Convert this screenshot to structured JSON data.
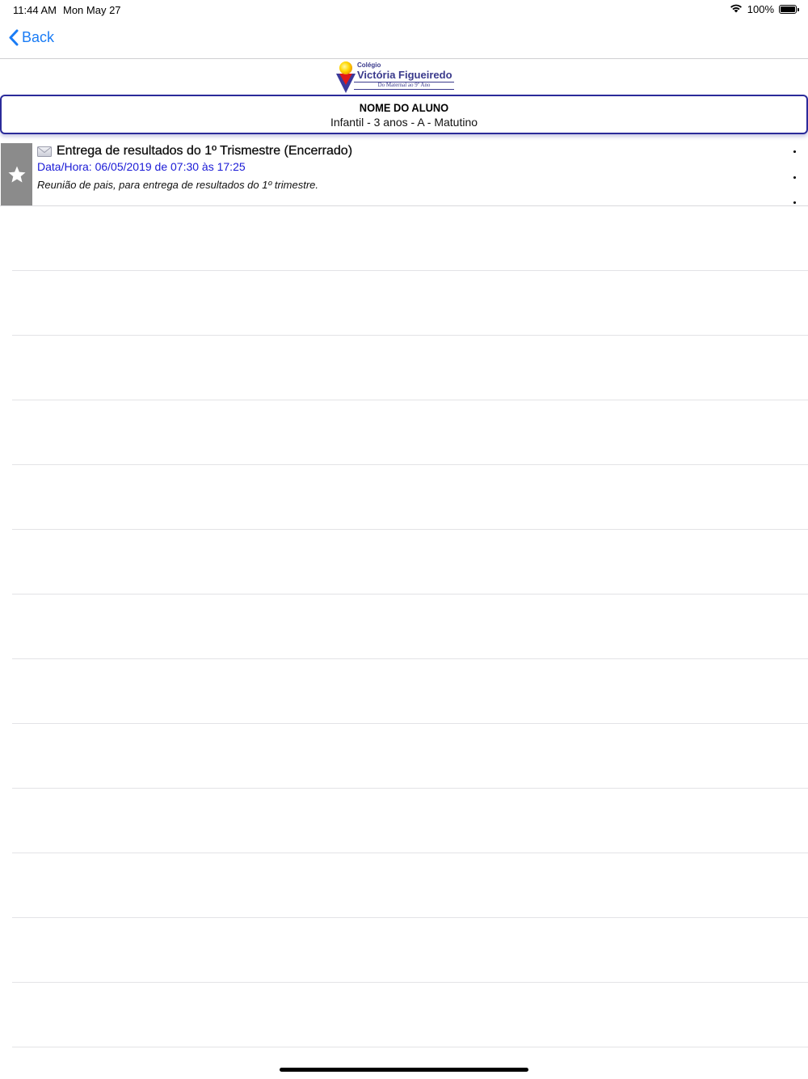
{
  "status_bar": {
    "time": "11:44 AM",
    "date": "Mon May 27",
    "battery_text": "100%",
    "battery_level": 1.0,
    "icons": [
      "wifi-icon",
      "battery-icon"
    ]
  },
  "nav": {
    "back_label": "Back",
    "back_icon": "chevron-left-icon",
    "accent_color": "#1a7cf5"
  },
  "logo": {
    "small": "Colégio",
    "name": "Victória Figueiredo",
    "tagline": "Do Maternal ao 9º Ano"
  },
  "student": {
    "name": "NOME DO ALUNO",
    "class_info": "Infantil - 3 anos - A - Matutino",
    "border_color": "#2b2b9a"
  },
  "events": [
    {
      "title": "Entrega de resultados do 1º Trismestre (Encerrado)",
      "datetime": "Data/Hora: 06/05/2019 de 07:30 às 17:25",
      "description": "Reunião de pais, para entrega de resultados do 1º trimestre.",
      "icon": "envelope-icon",
      "badge_icon": "star-icon",
      "date_color": "#1a1ad6"
    }
  ]
}
